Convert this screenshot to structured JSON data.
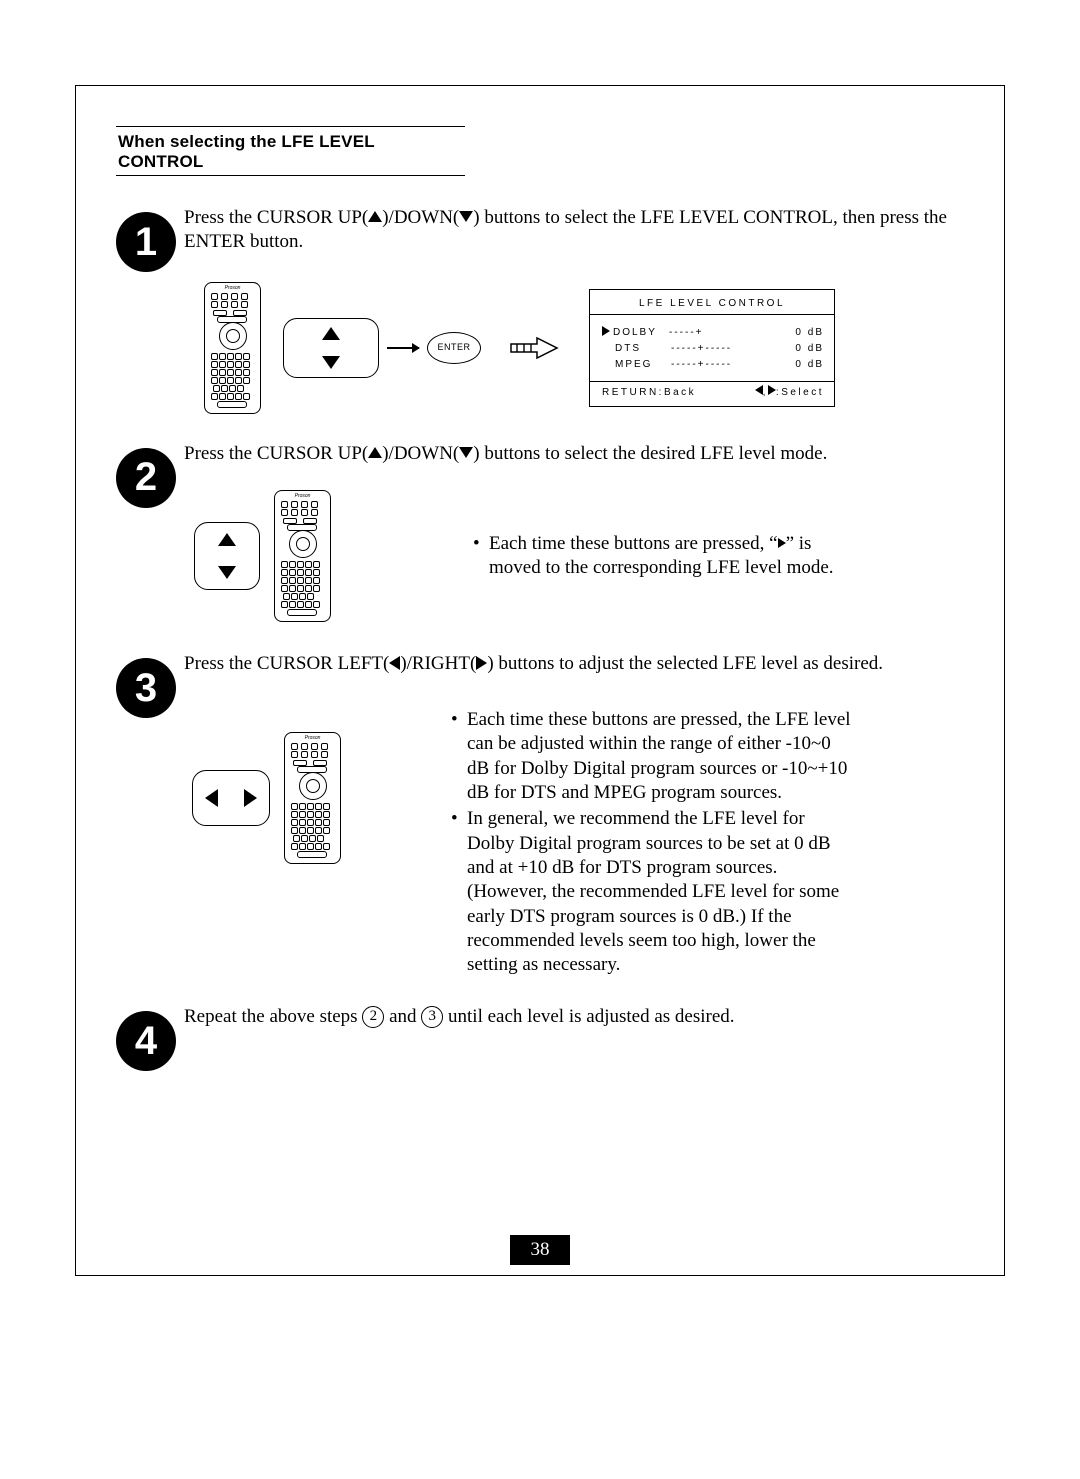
{
  "section_title": "When selecting the LFE LEVEL CONTROL",
  "steps": {
    "s1": {
      "num": "1",
      "text_a": "Press the CURSOR UP(",
      "text_b": ")/DOWN(",
      "text_c": ") buttons to select the LFE LEVEL CONTROL, then press the ENTER button.",
      "enter_label": "ENTER"
    },
    "s2": {
      "num": "2",
      "text_a": "Press the CURSOR UP(",
      "text_b": ")/DOWN(",
      "text_c": ") buttons to select the desired LFE level mode.",
      "note_a": "Each time these buttons are pressed, “",
      "note_b": "” is moved to the corresponding LFE level mode."
    },
    "s3": {
      "num": "3",
      "text_a": "Press the CURSOR LEFT(",
      "text_b": ")/RIGHT(",
      "text_c": ") buttons to adjust the selected LFE level as desired.",
      "note1": "Each time these buttons are pressed, the LFE level can be adjusted within the range of either -10~0 dB for Dolby Digital program sources or -10~+10 dB for DTS and MPEG program sources.",
      "note2": "In general, we recommend the LFE level for Dolby Digital program sources to be set at 0 dB and at +10 dB for DTS program sources.(However, the recommended LFE level for some early DTS program sources is 0 dB.) If the recommended levels seem too high, lower the setting as necessary."
    },
    "s4": {
      "num": "4",
      "text_a": "Repeat the above steps ",
      "circ2": "2",
      "text_b": " and ",
      "circ3": "3",
      "text_c": " until each level is adjusted as desired."
    }
  },
  "osd": {
    "title": "LFE LEVEL CONTROL",
    "rows": [
      {
        "label": "DOLBY",
        "value": "0  dB"
      },
      {
        "label": "DTS",
        "value": "0  dB"
      },
      {
        "label": "MPEG",
        "value": "0  dB"
      }
    ],
    "foot_left": "RETURN:Back",
    "foot_right": ":Select"
  },
  "page_number": "38"
}
